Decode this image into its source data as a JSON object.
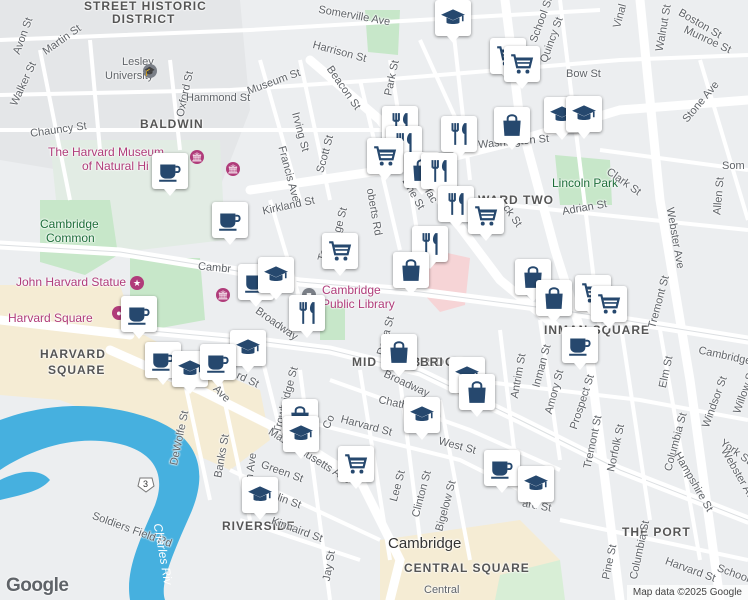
{
  "map": {
    "attribution": "Map data ©2025 Google",
    "logo": "Google",
    "areas": {
      "street_historic": "STREET HISTORIC",
      "district": "DISTRICT",
      "baldwin": "BALDWIN",
      "harvard_square_area": "HARVARD",
      "harvard_square_area2": "SQUARE",
      "riverside": "RIVERSIDE",
      "central_square": "CENTRAL SQUARE",
      "the_port": "THE PORT",
      "ward_two": "WARD TWO",
      "inman_square": "INMAN SQUARE",
      "mid_cambridge": "MID CAMBRIDGE",
      "cambridge_city": "Cambridge"
    },
    "pois": {
      "lesley1": "Lesley",
      "lesley2": "University",
      "museum1": "The Harvard Museum",
      "museum2": "of Natural Hi",
      "common1": "Cambridge",
      "common2": "Common",
      "statue": "John Harvard Statue",
      "harvard_sq": "Harvard Square",
      "library1": "Cambridge",
      "library2": "Public Library",
      "lincoln_park": "Lincoln Park",
      "central": "Central"
    },
    "streets": {
      "somerville": "Somerville Ave",
      "avon": "Avon St",
      "martin": "Martin St",
      "walker": "Walker St",
      "oxford": "Oxford St",
      "hammond": "Hammond St",
      "museum": "Museum St",
      "harrison": "Harrison St",
      "beacon": "Beacon St",
      "park": "Park St",
      "bow": "Bow St",
      "chauncy": "Chauncy St",
      "irving": "Irving St",
      "scott": "Scott St",
      "francis": "Francis Ave",
      "kirkland": "Kirkland St",
      "washington": "Washington St",
      "line": "Line St",
      "adrian": "Adrian St",
      "clark": "Clark St",
      "webster": "Webster Ave",
      "allen": "Allen St",
      "stone": "Stone Ave",
      "walnut": "Walnut St",
      "boston": "Boston St",
      "munroe": "Munroe St",
      "school": "School St",
      "quincy": "Quincy St",
      "vinal": "Vinal",
      "cambridge_st_w": "Cambr",
      "cambridge_st_e": "Cambridge",
      "broadway": "Broadway",
      "broadway2": "Broadway",
      "dana": "Dana St",
      "antrim": "Antrim St",
      "inman": "Inman St",
      "amory": "Amory St",
      "prospect": "Prospect St",
      "tremont": "Tremont St",
      "elm": "Elm St",
      "columbia": "Columbia St",
      "windsor": "Windsor St",
      "willow": "Willow St",
      "york": "York St",
      "hampshire": "Hampshire St",
      "webster2": "Webster Ave",
      "norfolk": "Norfolk St",
      "chatham": "Chatham St",
      "harvard_st": "Harvard St",
      "west": "West St",
      "trowbridge": "Trowbridge St",
      "banks": "Banks St",
      "dewolfe": "DeWolfe St",
      "mass_ave": "Massachusetts Ave",
      "green": "Green St",
      "franklin": "rklin St",
      "kinnaird": "Kinnaird St",
      "jay": "Jay St",
      "lee": "Lee St",
      "clinton": "Clinton St",
      "bigelow": "Bigelow St",
      "soldiers_field": "Soldiers Field Rd",
      "charles_river": "Charles Riv",
      "route3": "3",
      "tremont2": "Tremont St",
      "pine": "Pine St",
      "harvard2": "Harvard St",
      "columbia2": "Columbia St",
      "school2": "School St",
      "ward": "ard St",
      "roberts": "oberts Rd",
      "trowbridge_n": "Tr",
      "ge_st": "ge St",
      "lac": "lac",
      "ck_st": "ck St",
      "rd": "rd St",
      "ave": "Ave",
      "m_ave": "m Ave",
      "som": "Som",
      "brid": "BRI",
      "co": "Co"
    }
  },
  "markers": [
    {
      "type": "school",
      "icon": "graduation-cap-icon"
    },
    {
      "type": "grocery",
      "icon": "shopping-cart-icon"
    },
    {
      "type": "grocery",
      "icon": "shopping-cart-icon"
    },
    {
      "type": "shop",
      "icon": "shopping-bag-icon"
    },
    {
      "type": "school",
      "icon": "graduation-cap-icon"
    },
    {
      "type": "school",
      "icon": "graduation-cap-icon"
    },
    {
      "type": "restaurant",
      "icon": "fork-knife-icon"
    },
    {
      "type": "restaurant",
      "icon": "fork-knife-icon"
    },
    {
      "type": "restaurant",
      "icon": "fork-knife-icon"
    },
    {
      "type": "grocery",
      "icon": "shopping-cart-icon"
    },
    {
      "type": "shop",
      "icon": "shopping-bag-icon"
    },
    {
      "type": "restaurant",
      "icon": "fork-knife-icon"
    },
    {
      "type": "restaurant",
      "icon": "fork-knife-icon"
    },
    {
      "type": "grocery",
      "icon": "shopping-cart-icon"
    },
    {
      "type": "cafe",
      "icon": "coffee-cup-icon"
    },
    {
      "type": "cafe",
      "icon": "coffee-cup-icon"
    },
    {
      "type": "grocery",
      "icon": "shopping-cart-icon"
    },
    {
      "type": "restaurant",
      "icon": "fork-knife-icon"
    },
    {
      "type": "shop",
      "icon": "shopping-bag-icon"
    },
    {
      "type": "cafe",
      "icon": "coffee-cup-icon"
    },
    {
      "type": "school",
      "icon": "graduation-cap-icon"
    },
    {
      "type": "restaurant",
      "icon": "fork-knife-icon"
    },
    {
      "type": "cafe",
      "icon": "coffee-cup-icon"
    },
    {
      "type": "school",
      "icon": "graduation-cap-icon"
    },
    {
      "type": "cafe",
      "icon": "coffee-cup-icon"
    },
    {
      "type": "school",
      "icon": "graduation-cap-icon"
    },
    {
      "type": "cafe",
      "icon": "coffee-cup-icon"
    },
    {
      "type": "shop",
      "icon": "shopping-bag-icon"
    },
    {
      "type": "school",
      "icon": "graduation-cap-icon"
    },
    {
      "type": "shop",
      "icon": "shopping-bag-icon"
    },
    {
      "type": "school",
      "icon": "graduation-cap-icon"
    },
    {
      "type": "shop",
      "icon": "shopping-bag-icon"
    },
    {
      "type": "school",
      "icon": "graduation-cap-icon"
    },
    {
      "type": "grocery",
      "icon": "shopping-cart-icon"
    },
    {
      "type": "school",
      "icon": "graduation-cap-icon"
    },
    {
      "type": "cafe",
      "icon": "coffee-cup-icon"
    },
    {
      "type": "school",
      "icon": "graduation-cap-icon"
    },
    {
      "type": "shop",
      "icon": "shopping-bag-icon"
    },
    {
      "type": "shop",
      "icon": "shopping-bag-icon"
    },
    {
      "type": "grocery",
      "icon": "shopping-cart-icon"
    },
    {
      "type": "grocery",
      "icon": "shopping-cart-icon"
    },
    {
      "type": "cafe",
      "icon": "coffee-cup-icon"
    }
  ],
  "colors": {
    "land": "#eceef0",
    "road": "#ffffff",
    "major_road": "#f6f7f8",
    "park": "#c7e7c9",
    "campus": "#e4e6e8",
    "harvard_sq_zone": "#f5ecd4",
    "water": "#46b0df",
    "marker_icon": "#26486e",
    "pink_zone": "#f6d4d6"
  }
}
